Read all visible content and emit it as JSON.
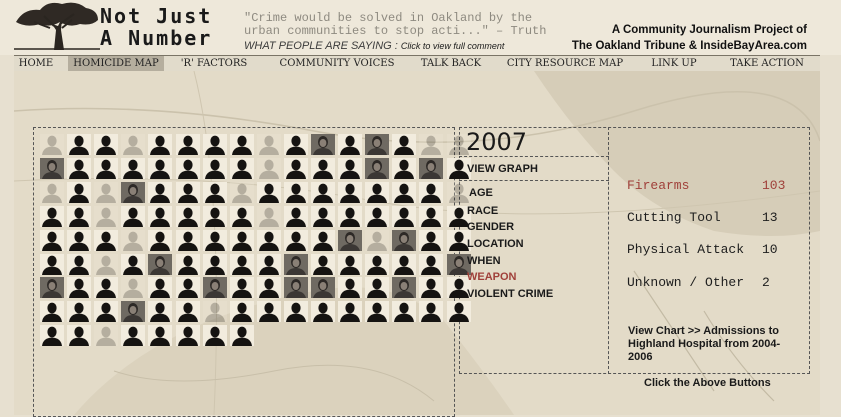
{
  "logo": {
    "line1": "Not Just",
    "line2": "A Number"
  },
  "quote": "\"Crime would be solved in Oakland by the urban communities to stop acti...\" – Truth",
  "saying": {
    "label": "WHAT PEOPLE ARE SAYING :",
    "link": "Click to view full comment"
  },
  "credit": {
    "line1": "A Community Journalism Project of",
    "line2": "The Oakland Tribune & InsideBayArea.com"
  },
  "nav": [
    "HOME",
    "HOMICIDE MAP",
    "'R' FACTORS",
    "COMMUNITY VOICES",
    "TALK BACK",
    "CITY RESOURCE MAP",
    "LINK UP",
    "TAKE ACTION"
  ],
  "nav_active": "HOMICIDE MAP",
  "year": "2007",
  "view_graph": "VIEW GRAPH",
  "categories": [
    "AGE",
    "RACE",
    "GENDER",
    "LOCATION",
    "WHEN",
    "WEAPON",
    "VIOLENT CRIME"
  ],
  "active_category": "WEAPON",
  "weapon_stats": [
    {
      "label": "Firearms",
      "value": "103",
      "active": true
    },
    {
      "label": "Cutting Tool",
      "value": "13",
      "active": false
    },
    {
      "label": "Physical Attack",
      "value": "10",
      "active": false
    },
    {
      "label": "Unknown / Other",
      "value": "2",
      "active": false
    }
  ],
  "chart_link": "View  Chart >>  Admissions to Highland Hospital from 2004-2006",
  "click_above": "Click the Above Buttons",
  "victim_grid_rows": [
    "DSSDSSSSDSPSPSDD",
    "PSSSSSSSDSSSPSPS",
    "DSDPSSSDSSSSSSSD",
    "SSDSSSSSDSSSSSSS",
    "SSSDSSSSSSSPDPSS",
    "SSDSPSSSSPSSSSSP",
    "PSSDSSPSSPPSSPSS",
    "SSSPSSDSSSSSSSSS",
    "SSDSSSSS"
  ]
}
